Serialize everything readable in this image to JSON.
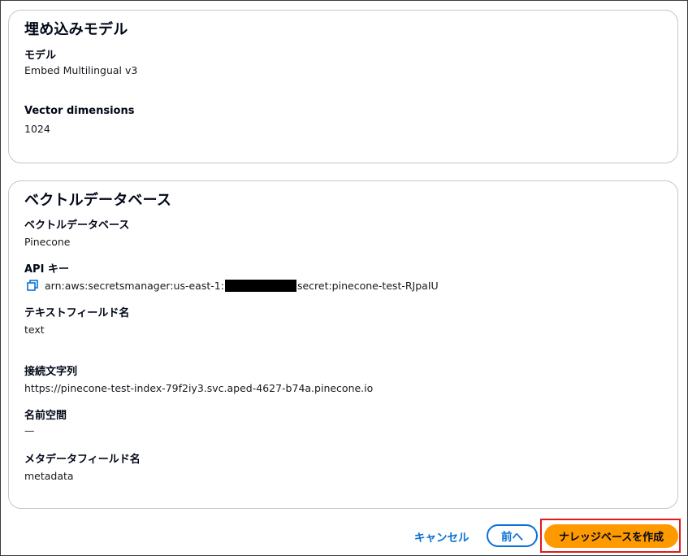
{
  "embedding_section": {
    "title": "埋め込みモデル",
    "model_label": "モデル",
    "model_value": "Embed Multilingual  v3",
    "dimensions_label": "Vector dimensions",
    "dimensions_value": "1024"
  },
  "vector_section": {
    "title": "ベクトルデータベース",
    "db_label": "ベクトルデータベース",
    "db_value": "Pinecone",
    "api_key_label": "API キー",
    "api_key_prefix": "arn:aws:secretsmanager:us-east-1:",
    "api_key_suffix": "secret:pinecone-test-RJpaIU",
    "text_field_label": "テキストフィールド名",
    "text_field_value": "text",
    "connection_label": "接続文字列",
    "connection_value": "https://pinecone-test-index-79f2iy3.svc.aped-4627-b74a.pinecone.io",
    "namespace_label": "名前空間",
    "namespace_value": "—",
    "metadata_label": "メタデータフィールド名",
    "metadata_value": "metadata"
  },
  "footer": {
    "cancel_label": "キャンセル",
    "prev_label": "前へ",
    "create_label": "ナレッジベースを作成"
  },
  "icons": {
    "copy": "copy-icon"
  },
  "colors": {
    "primary_button": "#ff9900",
    "link": "#0972d3",
    "highlight": "#e0191b"
  }
}
